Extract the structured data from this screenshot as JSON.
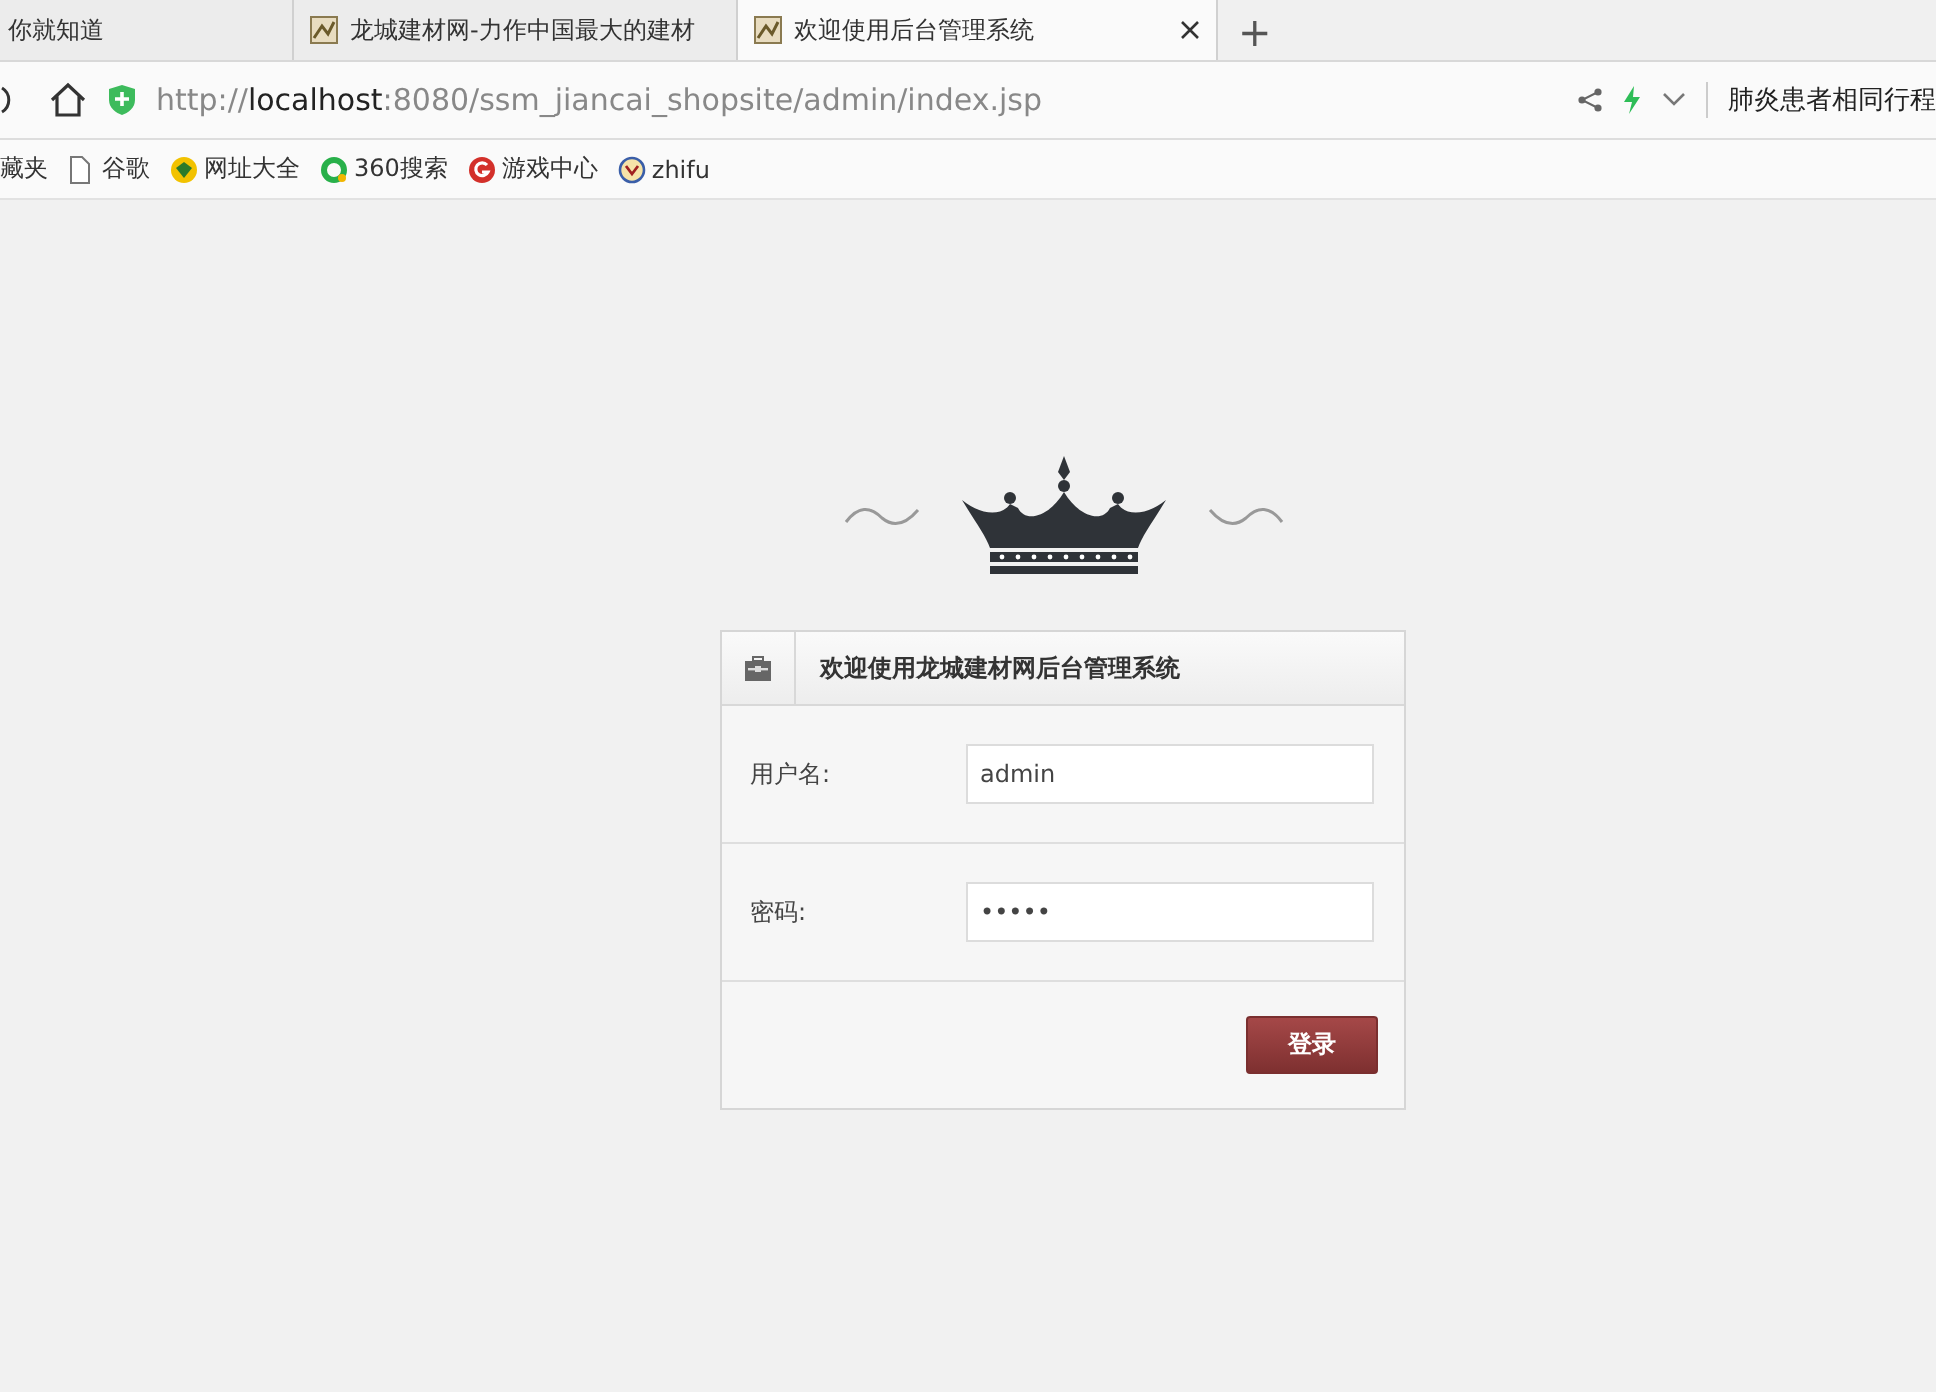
{
  "browser": {
    "tabs": [
      {
        "title": "你就知道",
        "selected": false
      },
      {
        "title": "龙城建材网-力作中国最大的建材",
        "selected": false
      },
      {
        "title": "欢迎使用后台管理系统",
        "selected": true
      }
    ],
    "new_tab": "+",
    "address": {
      "prefix": "http://",
      "host": "localhost",
      "path": ":8080/ssm_jiancai_shopsite/admin/index.jsp"
    },
    "news_ticker": "肺炎患者相同行程",
    "bookmarks": [
      {
        "label": "藏夹"
      },
      {
        "label": "谷歌"
      },
      {
        "label": "网址大全"
      },
      {
        "label": "360搜索"
      },
      {
        "label": "游戏中心"
      },
      {
        "label": "zhifu"
      }
    ]
  },
  "login": {
    "title": "欢迎使用龙城建材网后台管理系统",
    "fields": [
      {
        "label": "用户名:",
        "value": "admin"
      },
      {
        "label": "密码:",
        "value": "•••••"
      }
    ],
    "button": "登录"
  }
}
